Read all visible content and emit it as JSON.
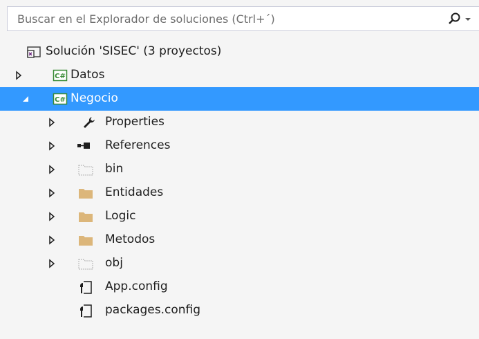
{
  "search": {
    "placeholder": "Buscar en el Explorador de soluciones (Ctrl+´)",
    "icon": "search-icon"
  },
  "colors": {
    "selection": "#3399ff",
    "folder": "#dcb67a",
    "csharp_green": "#388a34",
    "background": "#f5f5f5"
  },
  "tree": {
    "solution": "Solución 'SISEC'  (3 proyectos)",
    "items": [
      {
        "label": "Datos",
        "icon": "csharp-project-icon",
        "expander": "collapsed"
      },
      {
        "label": "Negocio",
        "icon": "csharp-project-icon",
        "expander": "expanded",
        "selected": true
      },
      {
        "label": "Properties",
        "icon": "wrench-icon",
        "expander": "collapsed"
      },
      {
        "label": "References",
        "icon": "references-icon",
        "expander": "collapsed"
      },
      {
        "label": "bin",
        "icon": "hidden-folder-icon",
        "expander": "collapsed"
      },
      {
        "label": "Entidades",
        "icon": "folder-icon",
        "expander": "collapsed"
      },
      {
        "label": "Logic",
        "icon": "folder-icon",
        "expander": "collapsed"
      },
      {
        "label": "Metodos",
        "icon": "folder-icon",
        "expander": "collapsed"
      },
      {
        "label": "obj",
        "icon": "hidden-folder-icon",
        "expander": "collapsed"
      },
      {
        "label": "App.config",
        "icon": "config-file-icon",
        "expander": "none"
      },
      {
        "label": "packages.config",
        "icon": "config-file-icon",
        "expander": "none"
      }
    ]
  }
}
